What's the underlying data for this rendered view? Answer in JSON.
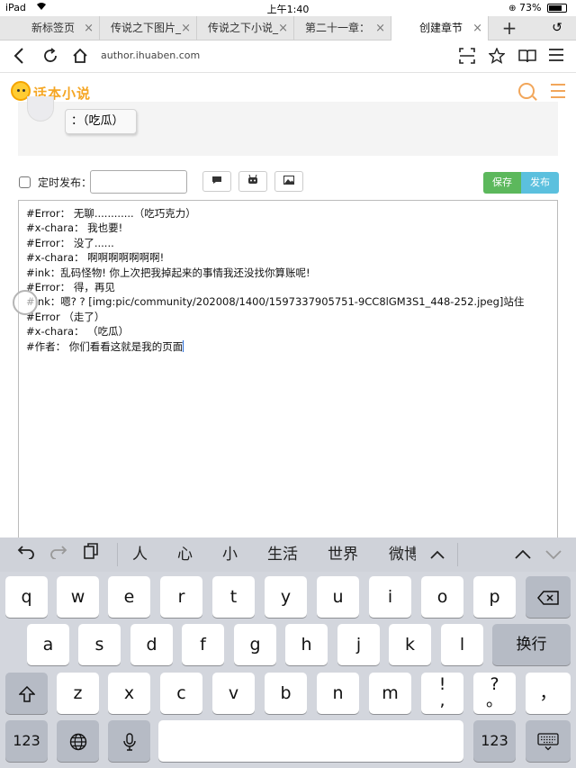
{
  "status": {
    "device": "iPad",
    "time": "上午1:40",
    "battery": "73%"
  },
  "tabs": [
    {
      "label": "新标签页"
    },
    {
      "label": "传说之下图片_"
    },
    {
      "label": "传说之下小说_"
    },
    {
      "label": "第二十一章："
    },
    {
      "label": "创建章节"
    }
  ],
  "tab_close": "×",
  "tab_new": "+",
  "address": {
    "url": "author.ihuaben.com"
  },
  "site": {
    "logo_text": "话本小说"
  },
  "preview": {
    "bubble_text": "：（吃瓜）"
  },
  "toolbar": {
    "schedule_label": "定时发布：",
    "schedule_value": "",
    "save_label": "保存",
    "publish_label": "发布"
  },
  "editor": {
    "lines": [
      "#Error：  无聊............（吃巧克力）",
      "#x-chara：  我也要!",
      "#Error：  没了......",
      "#x-chara：  啊啊啊啊啊啊啊!",
      "#ink：乱码怪物! 你上次把我掉起来的事情我还没找你算账呢!",
      "#Error：  得，再见",
      "#ink：嗯? ? [img:pic/community/202008/1400/1597337905751-9CC8lGM3S1_448-252.jpeg]站住",
      "#Error  （走了）",
      "#x-chara：  （吃瓜）",
      "#作者：  你们看看这就是我的页面"
    ]
  },
  "keyboard": {
    "suggestions": [
      "人",
      "心",
      "小",
      "生活",
      "世界",
      "微博"
    ],
    "row1": [
      "q",
      "w",
      "e",
      "r",
      "t",
      "y",
      "u",
      "i",
      "o",
      "p"
    ],
    "row2": [
      "a",
      "s",
      "d",
      "f",
      "g",
      "h",
      "j",
      "k",
      "l"
    ],
    "return_label": "换行",
    "row3": [
      "z",
      "x",
      "c",
      "v",
      "b",
      "n",
      "m"
    ],
    "punct1_top": "!",
    "punct1_bottom": ",",
    "punct2_top": "?",
    "punct2_bottom": "。",
    "punct3": "，",
    "num_label": "123"
  }
}
